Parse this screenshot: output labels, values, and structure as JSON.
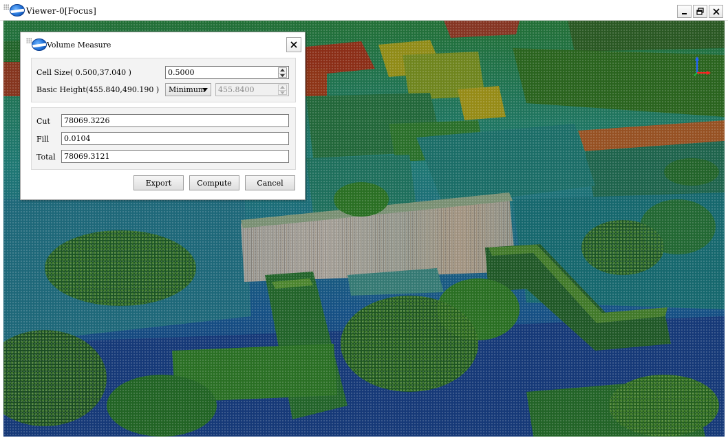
{
  "window": {
    "title": "Viewer-0[Focus]",
    "controls": [
      "minimize",
      "restore",
      "close"
    ]
  },
  "dialog": {
    "title": "Volume Measure",
    "cell_size": {
      "label": "Cell Size( 0.500,37.040 )",
      "value": "0.5000"
    },
    "basic_height": {
      "label": "Basic Height(455.840,490.190 )",
      "mode": "Minimum",
      "value": "455.8400"
    },
    "results": {
      "cut_label": "Cut",
      "cut_value": "78069.3226",
      "fill_label": "Fill",
      "fill_value": "0.0104",
      "total_label": "Total",
      "total_value": "78069.3121"
    },
    "buttons": {
      "export": "Export",
      "compute": "Compute",
      "cancel": "Cancel"
    }
  },
  "viewport": {
    "description_colors": [
      "#1d4fa8",
      "#1f8fa8",
      "#2aa860",
      "#3a8f2a",
      "#8cc020",
      "#d8b020",
      "#e07020",
      "#d04020"
    ]
  },
  "icons": [
    "app-logo-icon",
    "minimize-icon",
    "restore-icon",
    "close-icon",
    "axis-gizmo-icon",
    "spin-up-icon",
    "spin-down-icon",
    "dropdown-arrow-icon"
  ]
}
